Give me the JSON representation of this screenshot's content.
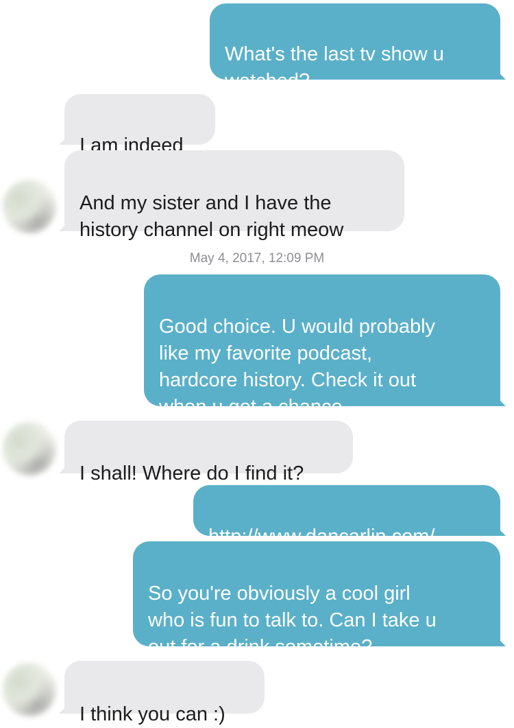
{
  "conversation": {
    "messages": [
      {
        "side": "out",
        "text": "What's the last tv show u\nwatched?"
      },
      {
        "side": "in",
        "text": "I am indeed"
      },
      {
        "side": "in",
        "text": "And my sister and I have the\nhistory channel on right meow"
      },
      {
        "side": "out",
        "text": "Good choice. U would probably\nlike my favorite podcast,\nhardcore history. Check it out\nwhen u get a chance."
      },
      {
        "side": "in",
        "text": "I shall! Where do I find it?"
      },
      {
        "side": "out",
        "text": "http://www.dancarlin.com/"
      },
      {
        "side": "out",
        "text": "So you're obviously a cool girl\nwho is fun to talk to. Can I take u\nout for a drink sometime?"
      },
      {
        "side": "in",
        "text": "I think you can :)"
      }
    ],
    "timestamp": "May 4, 2017, 12:09 PM"
  },
  "colors": {
    "outgoing_bubble": "#5ab0c8",
    "incoming_bubble": "#e9e9eb",
    "timestamp_text": "#8e8e93"
  },
  "icons": {
    "contact_avatar": "blurred-avatar-icon"
  }
}
